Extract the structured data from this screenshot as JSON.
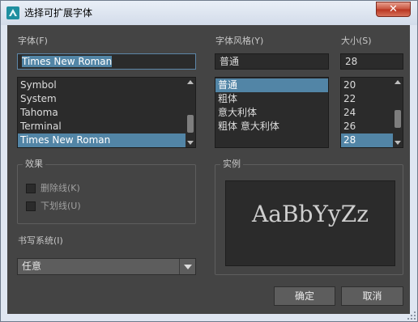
{
  "window": {
    "title": "选择可扩展字体",
    "close_glyph": "✕"
  },
  "font": {
    "label": "字体(F)",
    "value": "Times New Roman",
    "items": [
      "Symbol",
      "System",
      "Tahoma",
      "Terminal",
      "Times New Roman"
    ],
    "selected": "Times New Roman"
  },
  "style": {
    "label": "字体风格(Y)",
    "value": "普通",
    "items": [
      "普通",
      "粗体",
      "意大利体",
      "粗体 意大利体"
    ],
    "selected": "普通"
  },
  "size": {
    "label": "大小(S)",
    "value": "28",
    "items": [
      "20",
      "22",
      "24",
      "26",
      "28"
    ],
    "selected": "28"
  },
  "effects": {
    "label": "效果",
    "strikeout": {
      "label": "删除线(K)",
      "checked": false
    },
    "underline": {
      "label": "下划线(U)",
      "checked": false
    }
  },
  "sample": {
    "label": "实例",
    "text": "AaBbYyZz"
  },
  "script": {
    "label": "书写系统(I)",
    "value": "任意"
  },
  "buttons": {
    "ok": "确定",
    "cancel": "取消"
  },
  "colors": {
    "panel": "#444444",
    "field": "#2b2b2b",
    "selection": "#5285a6",
    "button": "#5d5d5d"
  },
  "icons": {
    "app": "app-logo-icon",
    "close": "close-icon",
    "scroll_up": "scroll-up-arrow-icon",
    "scroll_down": "scroll-down-arrow-icon",
    "dropdown": "chevron-down-icon",
    "resize": "resize-grip-icon"
  }
}
